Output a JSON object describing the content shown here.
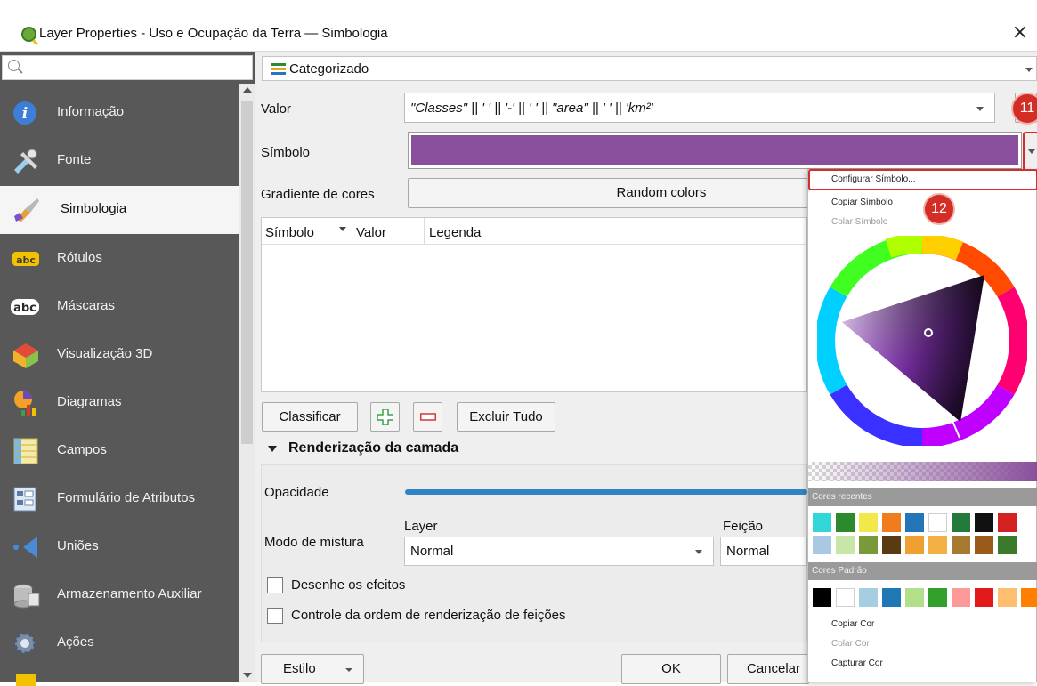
{
  "window": {
    "title": "Layer Properties - Uso e Ocupação da Terra — Simbologia",
    "close_glyph": "×"
  },
  "sidebar": {
    "items": [
      {
        "label": "Informação",
        "icon": "info-icon"
      },
      {
        "label": "Fonte",
        "icon": "source-icon"
      },
      {
        "label": "Simbologia",
        "icon": "paintbrush-icon",
        "active": true
      },
      {
        "label": "Rótulos",
        "icon": "labels-icon",
        "badge": "abc"
      },
      {
        "label": "Máscaras",
        "icon": "masks-icon",
        "badge": "abc"
      },
      {
        "label": "Visualização 3D",
        "icon": "3d-view-icon"
      },
      {
        "label": "Diagramas",
        "icon": "diagrams-icon"
      },
      {
        "label": "Campos",
        "icon": "fields-icon"
      },
      {
        "label": "Formulário de Atributos",
        "icon": "attributes-form-icon"
      },
      {
        "label": "Uniões",
        "icon": "joins-icon"
      },
      {
        "label": "Armazenamento Auxiliar",
        "icon": "auxiliary-storage-icon"
      },
      {
        "label": "Ações",
        "icon": "actions-icon"
      }
    ]
  },
  "renderer": {
    "type_label": "Categorizado",
    "valor_label": "Valor",
    "valor_expression": "\"Classes\" || ' ' || '-' || ' ' || \"area\" || ' ' || 'km²'",
    "simbolo_label": "Símbolo",
    "symbol_color": "#8a4f9c",
    "gradiente_label": "Gradiente de cores",
    "gradiente_value": "Random colors",
    "table_headers": [
      "Símbolo",
      "Valor",
      "Legenda"
    ],
    "btn_classificar": "Classificar",
    "btn_excluir_tudo": "Excluir Tudo"
  },
  "layer_rendering": {
    "section_title": "Renderização da camada",
    "opacidade_label": "Opacidade",
    "modo_mistura_label": "Modo de mistura",
    "layer_col_label": "Layer",
    "feicao_col_label": "Feição",
    "layer_blend": "Normal",
    "feicao_blend": "Normal",
    "desenhe_efeitos": "Desenhe os efeitos",
    "controle_ordem": "Controle da ordem de renderização de feições"
  },
  "footer": {
    "estilo": "Estilo",
    "ok": "OK",
    "cancelar": "Cancelar"
  },
  "badges": {
    "step11": "11",
    "step12": "12"
  },
  "popup": {
    "configurar": "Configurar Símbolo...",
    "copiar_simbolo": "Copiar Símbolo",
    "colar_simbolo": "Colar Símbolo",
    "cores_recentes": "Cores recentes",
    "cores_padrao": "Cores Padrão",
    "copiar_cor": "Copiar Cor",
    "colar_cor": "Colar Cor",
    "capturar_cor": "Capturar Cor",
    "recent_row1": [
      "#32d6d6",
      "#2c8a2c",
      "#f2e84a",
      "#ef7d1e",
      "#2474b8",
      "#ffffff",
      "#247a3a",
      "#111111",
      "#d42121"
    ],
    "recent_row2": [
      "#a8c8e4",
      "#c8e6a8",
      "#7a9a3a",
      "#5a3a12",
      "#f0a030",
      "#f2b045",
      "#a87a30",
      "#9a5a1a",
      "#3a7a2a"
    ],
    "standard_row": [
      "#000000",
      "#ffffff",
      "#a6cee3",
      "#1f78b4",
      "#b2df8a",
      "#33a02c",
      "#fb9a99",
      "#e31a1c",
      "#fdbf6f",
      "#ff7f00"
    ]
  }
}
